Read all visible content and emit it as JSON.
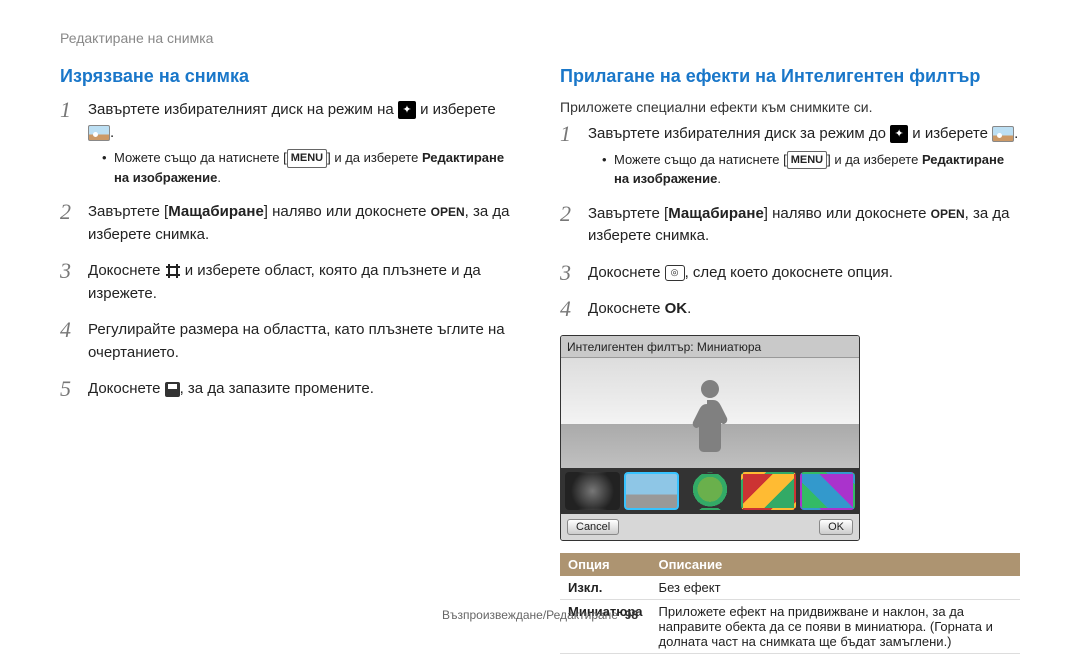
{
  "page_header": "Редактиране на снимка",
  "left": {
    "title": "Изрязване на снимка",
    "step1_a": "Завъртете избирателният диск на режим на ",
    "step1_b": " и изберете ",
    "step1_c": ".",
    "sub1_a": "Можете също да натиснете [",
    "sub1_menu": "MENU",
    "sub1_b": "] и да изберете ",
    "sub1_bold": "Редактиране на изображение",
    "sub1_c": ".",
    "step2_a": "Завъртете [",
    "step2_bold": "Мащабиране",
    "step2_b": "] наляво или докоснете ",
    "step2_open": "OPEN",
    "step2_c": ", за да изберете снимка.",
    "step3_a": "Докоснете ",
    "step3_b": " и изберете област, която да плъзнете и да изрежете.",
    "step4": "Регулирайте размера на областта, като плъзнете ъглите на очертанието.",
    "step5_a": "Докоснете ",
    "step5_b": ", за да запазите промените."
  },
  "right": {
    "title": "Прилагане на ефекти на Интелигентен филтър",
    "intro": "Приложете специални ефекти към снимките си.",
    "step1_a": "Завъртете избирателния диск за режим до ",
    "step1_b": " и изберете ",
    "step1_c": ".",
    "sub1_a": "Можете също да натиснете [",
    "sub1_menu": "MENU",
    "sub1_b": "] и да изберете ",
    "sub1_bold": "Редактиране на изображение",
    "sub1_c": ".",
    "step2_a": "Завъртете [",
    "step2_bold": "Мащабиране",
    "step2_b": "] наляво или докоснете ",
    "step2_open": "OPEN",
    "step2_c": ", за да изберете снимка.",
    "step3_a": "Докоснете ",
    "step3_b": ", след което докоснете опция.",
    "step4_a": "Докоснете ",
    "step4_ok": "OK",
    "step4_b": "."
  },
  "screen": {
    "label": "Интелигентен филтър: Миниатюра",
    "cancel": "Cancel",
    "ok": "OK"
  },
  "table": {
    "h1": "Опция",
    "h2": "Описание",
    "r1k": "Изкл.",
    "r1v": "Без ефект",
    "r2k": "Миниатюра",
    "r2v": "Приложете ефект на придвижване и наклон, за да направите обекта да се появи в миниатюра. (Горната и долната част на снимката ще бъдат замъглени.)"
  },
  "footer": {
    "text": "Възпроизвеждане/Редактиране",
    "page": "98"
  }
}
